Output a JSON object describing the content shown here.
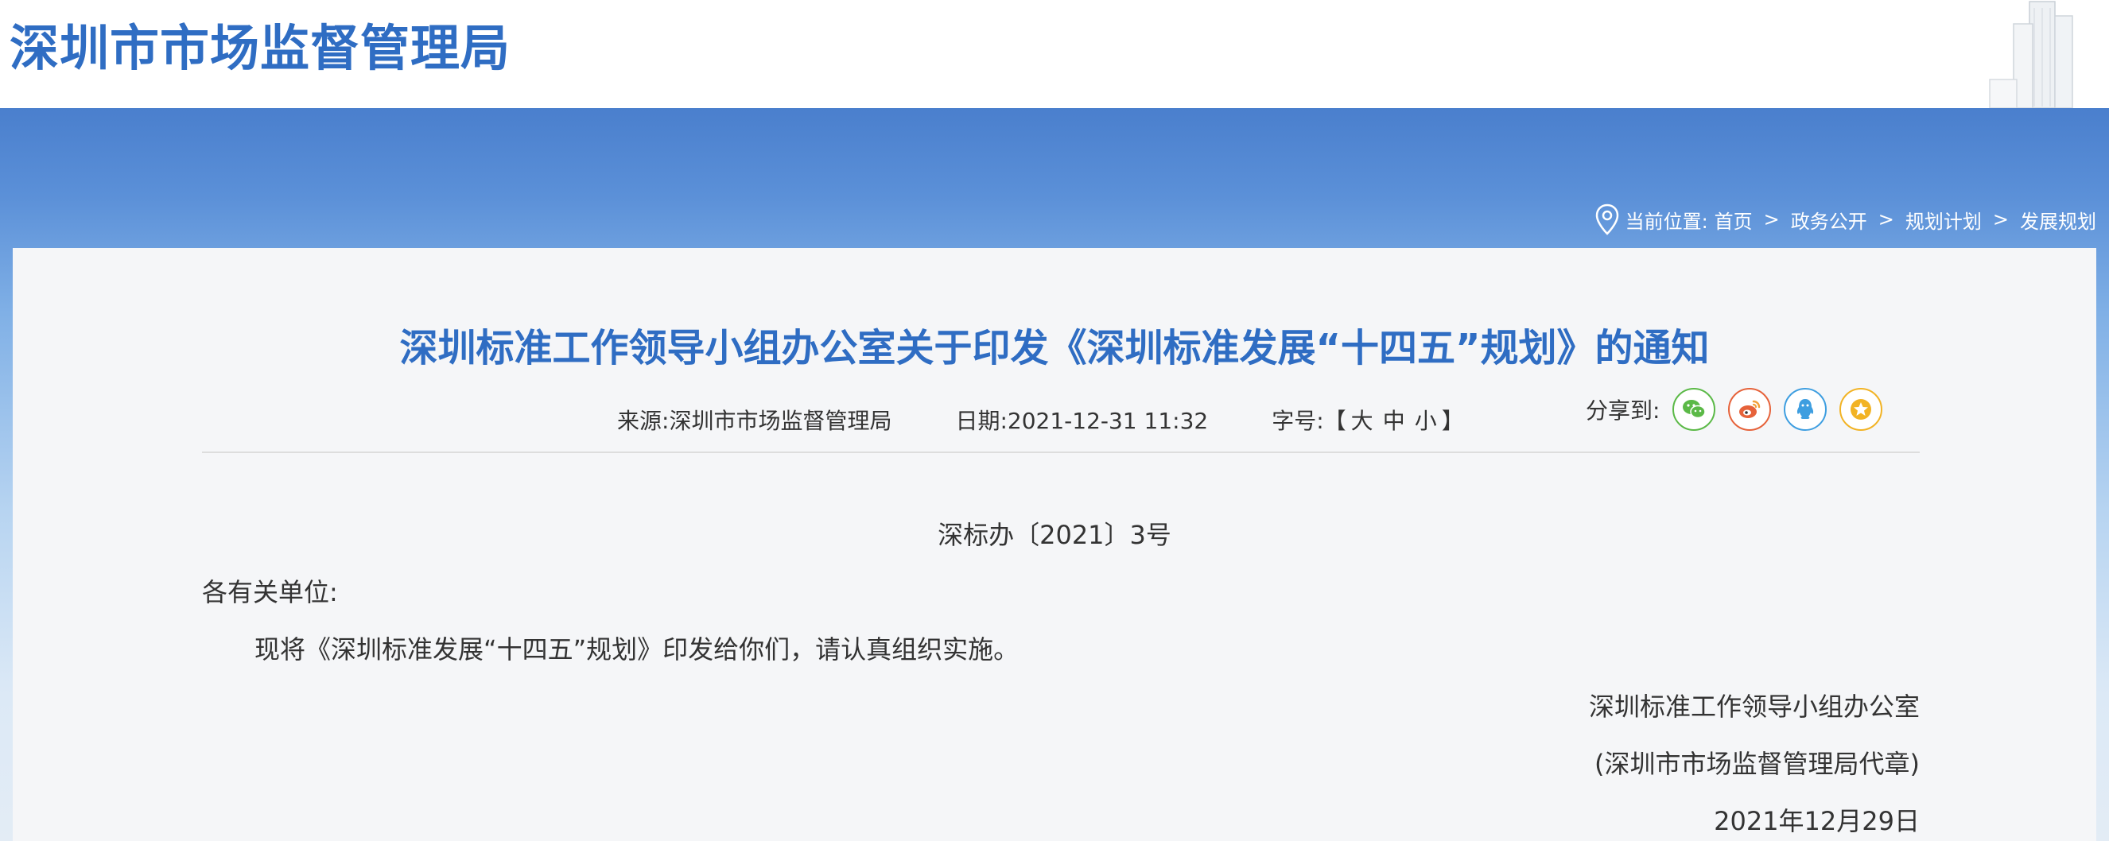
{
  "header": {
    "site_title": "深圳市市场监督管理局"
  },
  "breadcrumb": {
    "label": "当前位置:",
    "items": [
      "首页",
      "政务公开",
      "规划计划",
      "发展规划"
    ],
    "separator": ">"
  },
  "article": {
    "title": "深圳标准工作领导小组办公室关于印发《深圳标准发展“十四五”规划》的通知",
    "meta": {
      "source_label": "来源:",
      "source_value": "深圳市市场监督管理局",
      "date_label": "日期:",
      "date_value": "2021-12-31 11:32",
      "font_size_label": "字号:",
      "bracket_open": "【",
      "size_large": "大",
      "size_medium": "中",
      "size_small": "小",
      "bracket_close": "】"
    },
    "share": {
      "label": "分享到:",
      "buttons": [
        {
          "icon": "wechat-icon",
          "color": "#5bb947"
        },
        {
          "icon": "weibo-icon",
          "color": "#e6623a"
        },
        {
          "icon": "qq-icon",
          "color": "#3e9ee0"
        },
        {
          "icon": "star-icon",
          "color": "#f2b324"
        }
      ]
    },
    "doc_number": "深标办〔2021〕3号",
    "salutation": "各有关单位:",
    "paragraph": "现将《深圳标准发展“十四五”规划》印发给你们，请认真组织实施。",
    "signature_org": "深圳标准工作领导小组办公室",
    "signature_seal": "(深圳市市场监督管理局代章)",
    "signature_date": "2021年12月29日"
  },
  "colors": {
    "brand": "#2f6dc3",
    "banner_top": "#4a7fcd",
    "panel_bg": "#f5f6f8",
    "text": "#333333"
  }
}
